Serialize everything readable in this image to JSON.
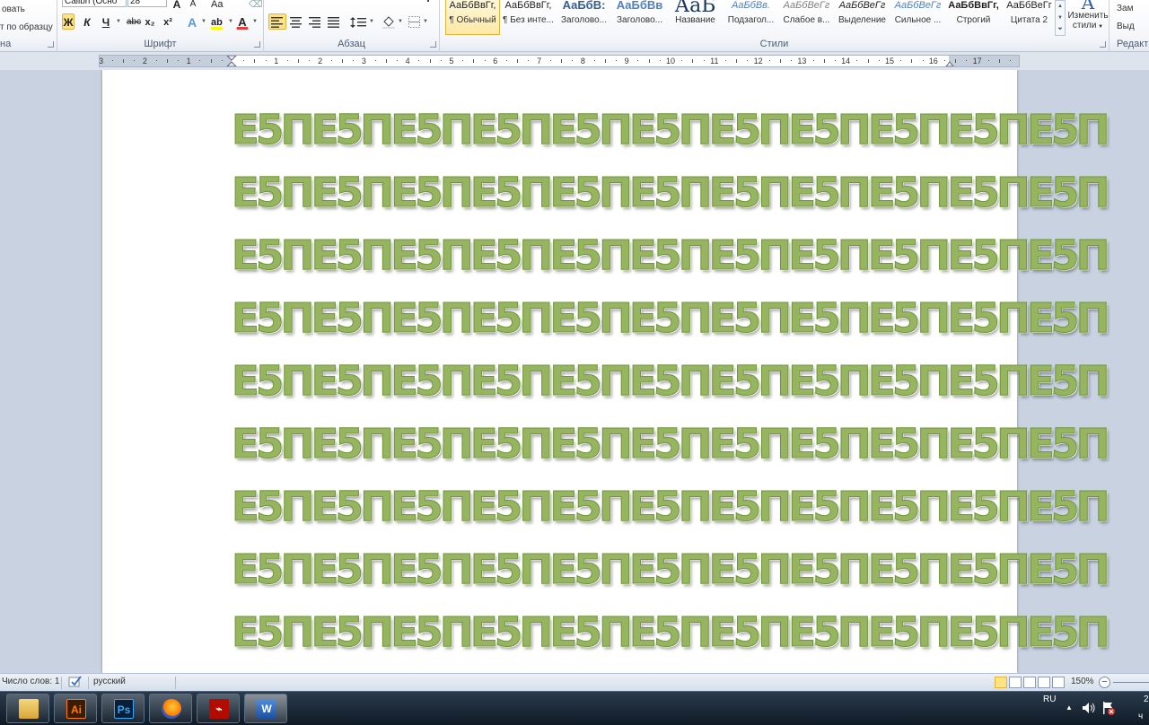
{
  "ribbon": {
    "clipboard": {
      "item1": "овать",
      "item2": "т по образцу",
      "label": "на"
    },
    "font": {
      "family": "Calibri (Осно",
      "size": "28",
      "grow": "A",
      "shrink": "A",
      "case": "Aa",
      "bold": "Ж",
      "italic": "К",
      "underline": "Ч",
      "strike": "abc",
      "sub": "x₂",
      "sup": "x²",
      "effects": "A",
      "highlight": "ab",
      "color": "A",
      "label": "Шрифт"
    },
    "paragraph": {
      "label": "Абзац"
    },
    "styles": {
      "label": "Стили",
      "items": [
        {
          "preview": "АаБбВвГг,",
          "name": "¶ Обычный",
          "color": "#1e1e1e",
          "selected": true
        },
        {
          "preview": "АаБбВвГг,",
          "name": "¶ Без инте...",
          "color": "#1e1e1e",
          "selected": false
        },
        {
          "preview": "АаБбВ:",
          "name": "Заголово...",
          "color": "#365f91",
          "selected": false
        },
        {
          "preview": "АаБбВв",
          "name": "Заголово...",
          "color": "#4f81bd",
          "selected": false
        },
        {
          "preview": "АаБ",
          "name": "Название",
          "color": "#17365d",
          "selected": false
        },
        {
          "preview": "АаБбВв.",
          "name": "Подзагол...",
          "color": "#4f81bd",
          "selected": false
        },
        {
          "preview": "АаБбВеГг",
          "name": "Слабое в...",
          "color": "#808080",
          "selected": false
        },
        {
          "preview": "АаБбВеГг",
          "name": "Выделение",
          "color": "#1e1e1e",
          "selected": false
        },
        {
          "preview": "АаБбВеГг",
          "name": "Сильное ...",
          "color": "#4f81bd",
          "selected": false
        },
        {
          "preview": "АаБбВвГг,",
          "name": "Строгий",
          "color": "#1e1e1e",
          "selected": false
        },
        {
          "preview": "АаБбВеГг",
          "name": "Цитата 2",
          "color": "#1e1e1e",
          "selected": false
        }
      ],
      "change_line1": "Изменить",
      "change_line2": "стили",
      "change_icon": "A"
    },
    "editing": {
      "item1": "Зам",
      "item2": "Выд",
      "label": "Редакти"
    }
  },
  "ruler": {
    "labels": [
      "3",
      "2",
      "1",
      "1",
      "2",
      "3",
      "4",
      "5",
      "6",
      "7",
      "8",
      "9",
      "10",
      "11",
      "12",
      "13",
      "14",
      "15",
      "16",
      "17"
    ]
  },
  "document": {
    "lines": [
      "Е5ПЕ5ПЕ5ПЕ5ПЕ5ПЕ5ПЕ5ПЕ5ПЕ5ПЕ5ПЕ5П",
      "Е5ПЕ5ПЕ5ПЕ5ПЕ5ПЕ5ПЕ5ПЕ5ПЕ5ПЕ5ПЕ5П",
      "Е5ПЕ5ПЕ5ПЕ5ПЕ5ПЕ5ПЕ5ПЕ5ПЕ5ПЕ5ПЕ5П",
      "Е5ПЕ5ПЕ5ПЕ5ПЕ5ПЕ5ПЕ5ПЕ5ПЕ5ПЕ5ПЕ5П",
      "Е5ПЕ5ПЕ5ПЕ5ПЕ5ПЕ5ПЕ5ПЕ5ПЕ5ПЕ5ПЕ5П",
      "Е5ПЕ5ПЕ5ПЕ5ПЕ5ПЕ5ПЕ5ПЕ5ПЕ5ПЕ5ПЕ5П",
      "Е5ПЕ5ПЕ5ПЕ5ПЕ5ПЕ5ПЕ5ПЕ5ПЕ5ПЕ5ПЕ5П",
      "Е5ПЕ5ПЕ5ПЕ5ПЕ5ПЕ5ПЕ5ПЕ5ПЕ5ПЕ5ПЕ5П",
      "Е5ПЕ5ПЕ5ПЕ5ПЕ5ПЕ5ПЕ5ПЕ5ПЕ5ПЕ5ПЕ5П"
    ],
    "text_color": "#97b560"
  },
  "status": {
    "word_count": "Число слов: 1",
    "language": "русский",
    "zoom": "150%",
    "zoom_out": "−"
  },
  "taskbar": {
    "apps": [
      {
        "name": "explorer",
        "label": "",
        "active": false
      },
      {
        "name": "illustrator",
        "label": "Ai",
        "active": false
      },
      {
        "name": "photoshop",
        "label": "Ps",
        "active": false
      },
      {
        "name": "firefox",
        "label": "",
        "active": false
      },
      {
        "name": "acrobat",
        "label": "",
        "active": false
      },
      {
        "name": "word",
        "label": "W",
        "active": true
      }
    ],
    "lang": "RU",
    "clock_top": "2",
    "clock_bottom": "ч"
  }
}
